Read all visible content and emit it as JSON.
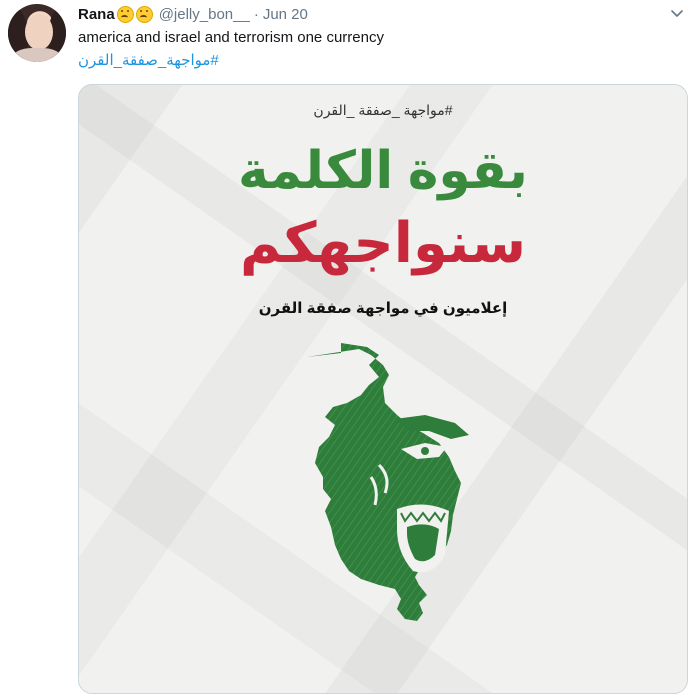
{
  "tweet": {
    "name": "Rana",
    "emojis": [
      "upside-down-face-emoji",
      "upside-down-face-emoji"
    ],
    "handle": "@jelly_bon__",
    "separator": "·",
    "date": "Jun 20",
    "text": "america and israel and terrorism one currency",
    "hashtag": "#مواجهة_صفقة_القرن"
  },
  "poster": {
    "hashtag": "#مواجهة _صفقة _القرن",
    "line1": "بقوة الكلمة",
    "line2": "سنواجهكم",
    "subtitle": "إعلاميون في مواجهة صفقة القرن",
    "colors": {
      "line1": "#3a8a3e",
      "line2": "#c8283c",
      "illustration": "#2f7d3b",
      "background": "#f1f1ef"
    }
  },
  "icons": [
    "chevron-down-icon"
  ]
}
